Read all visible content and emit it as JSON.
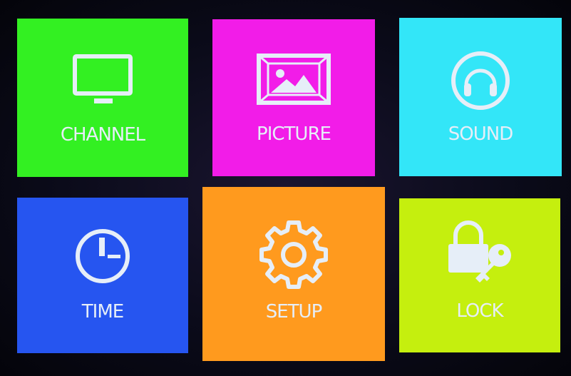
{
  "menu": {
    "tiles": [
      {
        "label": "CHANNEL",
        "icon": "tv-monitor-icon",
        "color": "#33f022"
      },
      {
        "label": "PICTURE",
        "icon": "picture-frame-icon",
        "color": "#f21ce8"
      },
      {
        "label": "SOUND",
        "icon": "headphones-icon",
        "color": "#33e6f8"
      },
      {
        "label": "TIME",
        "icon": "clock-icon",
        "color": "#2655f0"
      },
      {
        "label": "SETUP",
        "icon": "gear-icon",
        "color": "#ff9a1e"
      },
      {
        "label": "LOCK",
        "icon": "lock-key-icon",
        "color": "#c5ef0e"
      }
    ]
  }
}
